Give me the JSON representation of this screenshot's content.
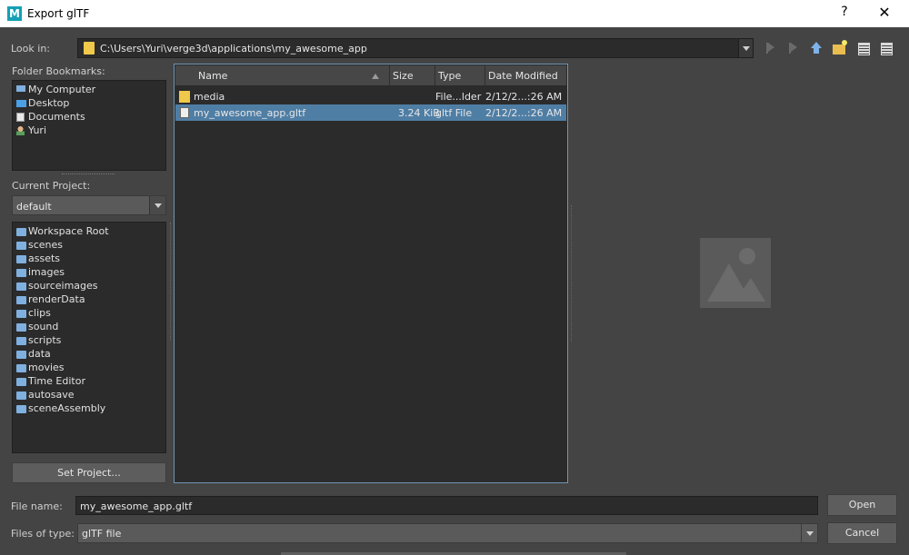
{
  "window": {
    "title": "Export glTF",
    "app_icon_letter": "M",
    "help_label": "?",
    "close_label": "✕"
  },
  "look_in": {
    "label": "Look in:",
    "path": "C:\\Users\\Yuri\\verge3d\\applications\\my_awesome_app"
  },
  "toolbar": {
    "icons": [
      "back-icon",
      "forward-icon",
      "up-folder-icon",
      "new-folder-icon",
      "list-view-icon",
      "detail-view-icon"
    ]
  },
  "bookmarks": {
    "label": "Folder Bookmarks:",
    "items": [
      {
        "label": "My Computer",
        "icon": "computer-icon"
      },
      {
        "label": "Desktop",
        "icon": "desktop-icon"
      },
      {
        "label": "Documents",
        "icon": "documents-icon"
      },
      {
        "label": "Yuri",
        "icon": "user-icon"
      }
    ]
  },
  "project": {
    "label": "Current Project:",
    "selected": "default",
    "folders": [
      "Workspace Root",
      "scenes",
      "assets",
      "images",
      "sourceimages",
      "renderData",
      "clips",
      "sound",
      "scripts",
      "data",
      "movies",
      "Time Editor",
      "autosave",
      "sceneAssembly"
    ],
    "set_button": "Set Project..."
  },
  "file_list": {
    "columns": [
      "Name",
      "Size",
      "Type",
      "Date Modified"
    ],
    "rows": [
      {
        "name": "media",
        "size": "",
        "type": "File...lder",
        "date": "2/12/2...:26 AM",
        "icon": "folder-icon",
        "selected": false
      },
      {
        "name": "my_awesome_app.gltf",
        "size": "3.24 KiB",
        "type": "gltf File",
        "date": "2/12/2...:26 AM",
        "icon": "gltf-file-icon",
        "selected": true
      }
    ]
  },
  "file_name": {
    "label": "File name:",
    "value": "my_awesome_app.gltf"
  },
  "file_type": {
    "label": "Files of type:",
    "value": "glTF file"
  },
  "buttons": {
    "open": "Open",
    "cancel": "Cancel"
  },
  "colors": {
    "background": "#444444",
    "panel": "#2b2b2b",
    "selection": "#4f7ea5",
    "folder": "#f0c84a",
    "bookmark_folder": "#7fb0e0"
  }
}
